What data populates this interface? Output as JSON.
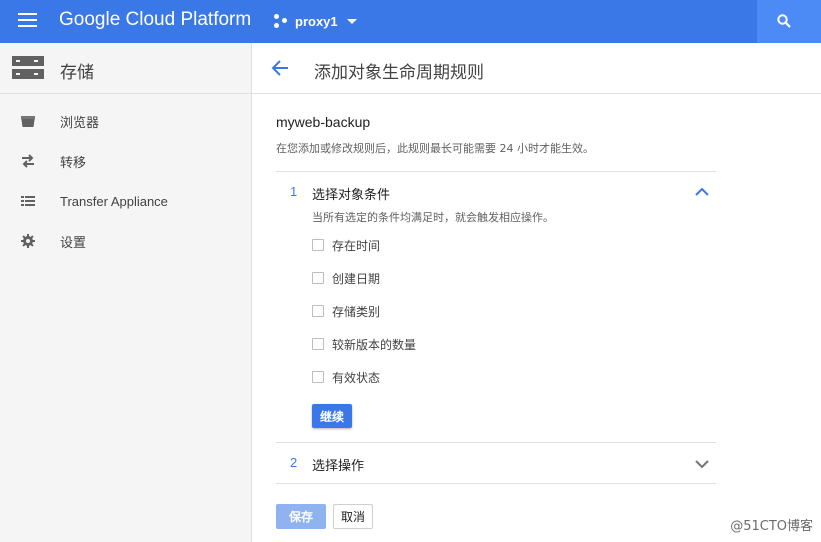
{
  "topbar": {
    "menu_icon": "hamburger-menu-icon",
    "brand": "Google Cloud Platform",
    "project": "proxy1",
    "project_icon": "project-dots-icon",
    "search_icon": "search-icon",
    "color": "#3b78e7"
  },
  "sidebar": {
    "title": "存储",
    "title_icon": "storage-icon",
    "items": [
      {
        "label": "浏览器",
        "icon": "bucket-icon"
      },
      {
        "label": "转移",
        "icon": "transfer-arrows-icon"
      },
      {
        "label": "Transfer Appliance",
        "icon": "list-icon"
      },
      {
        "label": "设置",
        "icon": "gear-icon"
      }
    ]
  },
  "main": {
    "back_icon": "arrow-back-icon",
    "title": "添加对象生命周期规则",
    "bucket_name": "myweb-backup",
    "note": "在您添加或修改规则后，此规则最长可能需要 24 小时才能生效。",
    "step1": {
      "number": "1",
      "title": "选择对象条件",
      "description": "当所有选定的条件均满足时，就会触发相应操作。",
      "conditions": [
        "存在时间",
        "创建日期",
        "存储类别",
        "较新版本的数量",
        "有效状态"
      ],
      "continue_label": "继续",
      "expanded": true
    },
    "step2": {
      "number": "2",
      "title": "选择操作",
      "expanded": false
    },
    "save_label": "保存",
    "cancel_label": "取消"
  },
  "watermark": "@51CTO博客"
}
